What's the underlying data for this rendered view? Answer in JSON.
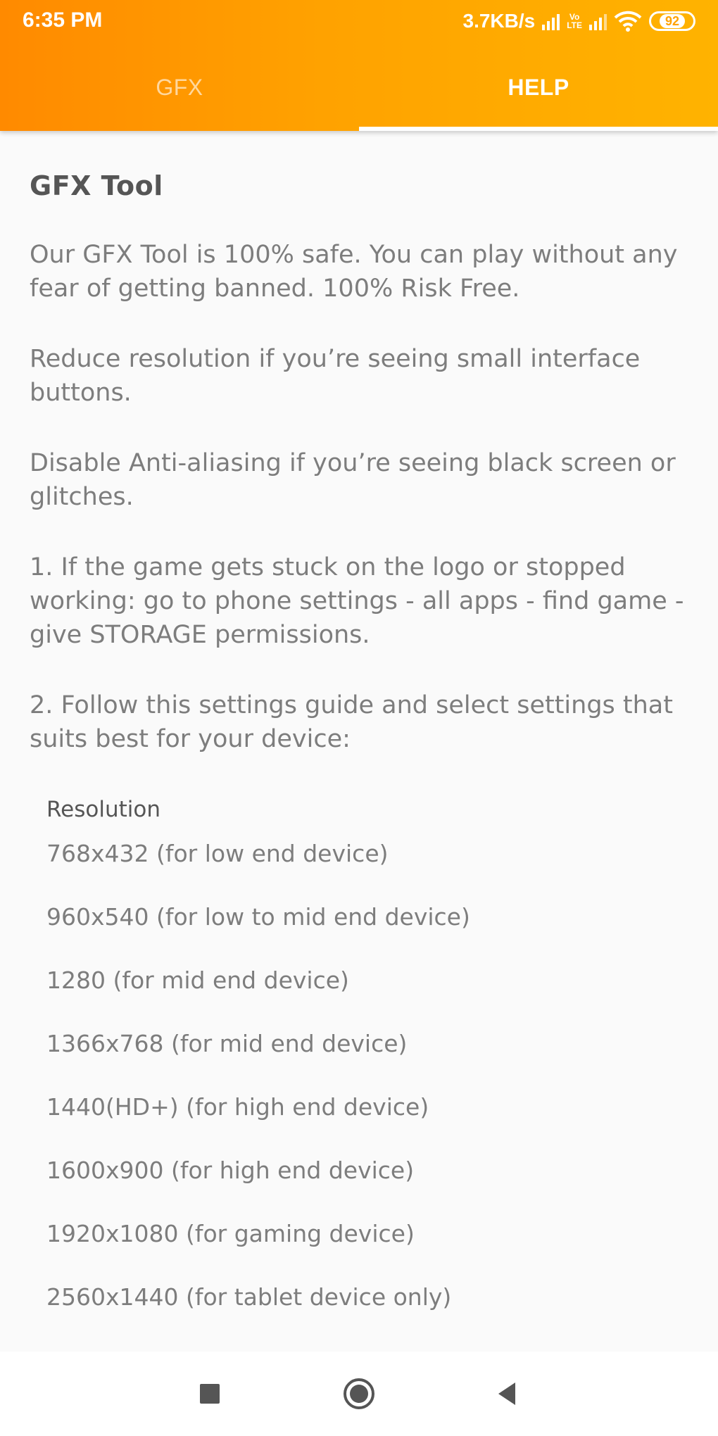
{
  "status_bar": {
    "time": "6:35 PM",
    "net_speed": "3.7KB/s",
    "volte_top": "Vo",
    "volte_bottom": "LTE",
    "battery": "92",
    "icons": [
      "signal-icon",
      "volte-icon",
      "signal-icon",
      "wifi-icon",
      "battery-icon"
    ]
  },
  "tabs": [
    {
      "label": "GFX",
      "selected": false
    },
    {
      "label": "HELP",
      "selected": true
    }
  ],
  "colors": {
    "header_start": "#ff8a00",
    "header_end": "#ffb300",
    "background": "#fafafa",
    "text": "#7d7d7d",
    "heading": "#555555"
  },
  "content": {
    "title": "GFX Tool",
    "paragraphs": [
      "Our GFX Tool is 100% safe. You can play without any fear of getting banned. 100% Risk Free.",
      "Reduce resolution if you’re seeing small interface buttons.",
      "Disable Anti-aliasing if you’re seeing black screen or glitches.",
      "1. If the game gets stuck on the logo or stopped working: go to phone settings - all apps - find game -  give STORAGE permissions.",
      "2. Follow this settings guide and select settings that suits best for your device:"
    ],
    "settings_heading": "Resolution",
    "resolutions": [
      "768x432 (for low end device)",
      "960x540 (for low to mid end device)",
      "1280 (for mid end device)",
      "1366x768 (for mid end device)",
      "1440(HD+) (for high end device)",
      "1600x900 (for high end device)",
      "1920x1080 (for gaming device)",
      "2560x1440 (for tablet device only)"
    ]
  },
  "nav_bar": {
    "buttons": [
      "recents-icon",
      "home-icon",
      "back-icon"
    ]
  }
}
